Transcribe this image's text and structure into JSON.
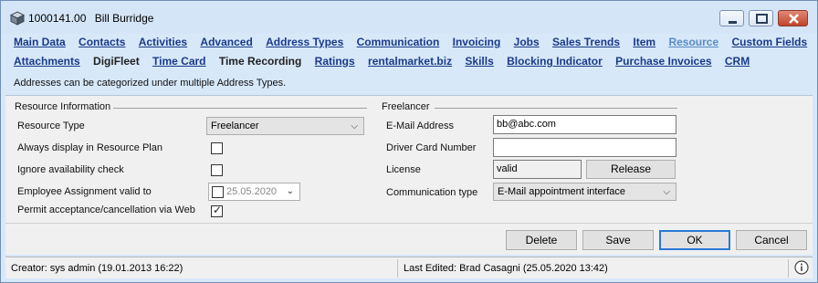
{
  "window": {
    "record_id": "1000141.00",
    "record_name": "Bill Burridge"
  },
  "nav": {
    "row1": [
      "Main Data",
      "Contacts",
      "Activities",
      "Advanced",
      "Address Types",
      "Communication",
      "Invoicing",
      "Jobs",
      "Sales Trends",
      "Item",
      "Resource",
      "Custom Fields"
    ],
    "row2": [
      "Attachments",
      "DigiFleet",
      "Time Card",
      "Time Recording",
      "Ratings",
      "rentalmarket.biz",
      "Skills",
      "Blocking Indicator",
      "Purchase Invoices",
      "CRM"
    ]
  },
  "info_text": "Addresses can be categorized under multiple Address Types.",
  "resource_info": {
    "title": "Resource Information",
    "resource_type_label": "Resource Type",
    "resource_type_value": "Freelancer",
    "always_display_label": "Always display in Resource Plan",
    "always_display_checked": false,
    "ignore_availability_label": "Ignore availability check",
    "ignore_availability_checked": false,
    "employee_assignment_label": "Employee Assignment valid to",
    "employee_assignment_value": "25.05.2020",
    "employee_assignment_checked": false,
    "permit_acceptance_label": "Permit acceptance/cancellation via Web",
    "permit_acceptance_checked": true
  },
  "freelancer": {
    "title": "Freelancer",
    "email_label": "E-Mail Address",
    "email_value": "bb@abc.com",
    "driver_card_label": "Driver Card Number",
    "driver_card_value": "",
    "license_label": "License",
    "license_value": "valid",
    "release_label": "Release",
    "comm_type_label": "Communication type",
    "comm_type_value": "E-Mail appointment interface"
  },
  "buttons": {
    "delete": "Delete",
    "save": "Save",
    "ok": "OK",
    "cancel": "Cancel"
  },
  "status": {
    "creator": "Creator: sys admin (19.01.2013 16:22)",
    "last_edited": "Last Edited:  Brad Casagni (25.05.2020 13:42)"
  },
  "icons": {
    "title": "resource-cube-icon",
    "info": "info-icon"
  },
  "colors": {
    "accent": "#2a7ad6",
    "link": "#1a3a8a",
    "link_disabled": "#5a8cc4",
    "window_bg": "#d7e8f9"
  }
}
